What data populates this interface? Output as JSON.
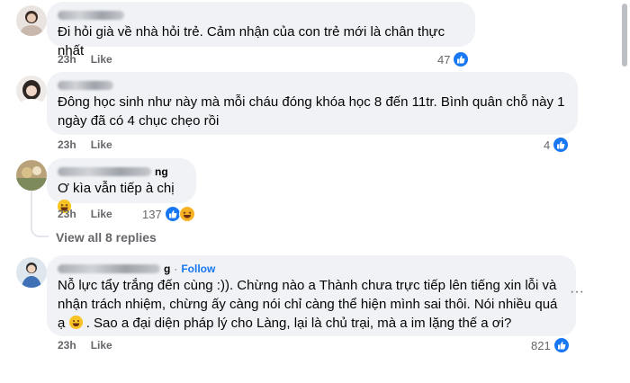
{
  "comments": [
    {
      "text": "Đi hỏi già về nhà hỏi trẻ. Cảm nhận của con trẻ mới là chân thực nhất",
      "time": "23h",
      "like": "Like",
      "reactions": "47"
    },
    {
      "text": "Đông học sinh như này mà mỗi cháu đóng khóa học 8 đến 11tr. Bình quân chỗ này 1 ngày đã có 4 chục chẹo rồi",
      "time": "23h",
      "like": "Like",
      "reactions": "4"
    },
    {
      "author_suffix": "ng",
      "text": "Ơ kìa vẫn tiếp à chị",
      "time": "23h",
      "like": "Like",
      "reactions": "137"
    },
    {
      "author_suffix": "g",
      "follow": "Follow",
      "text": "Nỗ lực tẩy trắng đến cùng :)). Chừng nào a Thành chưa trực tiếp lên tiếng xin lỗi và nhận trách nhiệm, chừng ấy càng nói chỉ càng thể hiện mình sai thôi. Nói nhiều quá ạ",
      "text2": ". Sao a đại diện pháp lý cho Làng, lại là chủ trại, mà a im lặng thế a ơi?",
      "time": "23h",
      "like": "Like",
      "reactions": "821"
    }
  ],
  "view_replies": "View all 8 replies",
  "more_options": "···",
  "colors": {
    "like_blue": "#1877f2",
    "bubble_bg": "#f0f2f5",
    "meta_gray": "#65676b"
  },
  "icons": [
    "like-icon",
    "haha-icon",
    "more-options-icon",
    "grin-emoji"
  ]
}
